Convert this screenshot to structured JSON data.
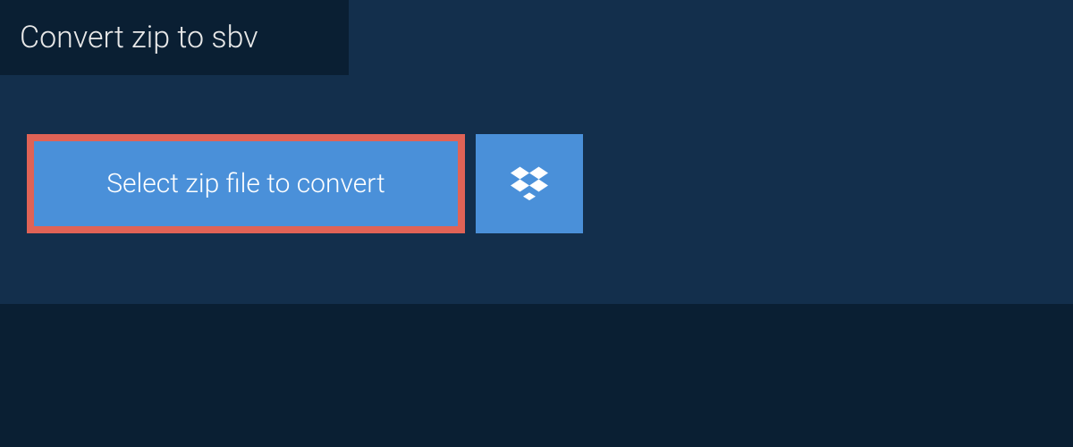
{
  "tab": {
    "label": "Convert zip to sbv"
  },
  "buttons": {
    "select_file_label": "Select zip file to convert"
  },
  "colors": {
    "background_dark": "#0a1f33",
    "panel": "#132f4c",
    "button_primary": "#4a90d9",
    "highlight_border": "#e06356"
  }
}
